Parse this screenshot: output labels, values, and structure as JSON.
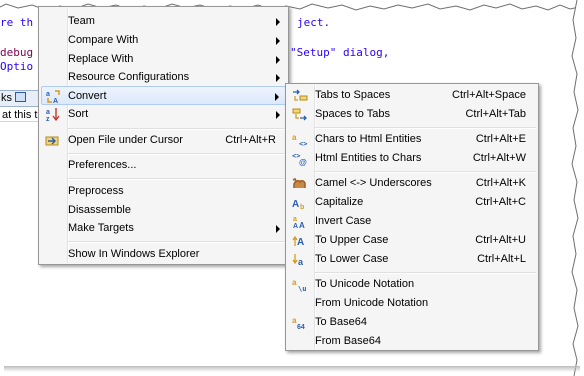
{
  "editor": {
    "lines": [
      {
        "text": "re th"
      },
      {
        "text": "ject."
      },
      {
        "text": "debug"
      },
      {
        "text": "\"Setup\" dialog,"
      },
      {
        "text": "Optio"
      }
    ],
    "tab_label": "ks",
    "status_text": "at this t"
  },
  "main_menu": {
    "items": [
      {
        "label": "Team",
        "accel": "",
        "submenu": true
      },
      {
        "label": "Compare With",
        "accel": "",
        "submenu": true
      },
      {
        "label": "Replace With",
        "accel": "",
        "submenu": true
      },
      {
        "label": "Resource Configurations",
        "accel": "",
        "submenu": true
      },
      {
        "label": "Convert",
        "accel": "",
        "submenu": true,
        "icon": "convert-icon"
      },
      {
        "label": "Sort",
        "accel": "",
        "submenu": true,
        "icon": "sort-az-icon"
      },
      {
        "label": "Open File under Cursor",
        "accel": "Ctrl+Alt+R",
        "submenu": false,
        "icon": "open-file-icon"
      },
      {
        "label": "Preferences...",
        "accel": "",
        "submenu": false
      },
      {
        "label": "Preprocess",
        "accel": "",
        "submenu": false
      },
      {
        "label": "Disassemble",
        "accel": "",
        "submenu": false
      },
      {
        "label": "Make Targets",
        "accel": "",
        "submenu": true
      },
      {
        "label": "Show In Windows Explorer",
        "accel": "",
        "submenu": false
      }
    ]
  },
  "convert_menu": {
    "items": [
      {
        "label": "Tabs to Spaces",
        "accel": "Ctrl+Alt+Space",
        "icon": "tabs-to-spaces-icon"
      },
      {
        "label": "Spaces to Tabs",
        "accel": "Ctrl+Alt+Tab",
        "icon": "spaces-to-tabs-icon"
      },
      {
        "label": "Chars to Html Entities",
        "accel": "Ctrl+Alt+E",
        "icon": "chars-to-html-icon"
      },
      {
        "label": "Html Entities to Chars",
        "accel": "Ctrl+Alt+W",
        "icon": "html-to-chars-icon"
      },
      {
        "label": "Camel <-> Underscores",
        "accel": "Ctrl+Alt+K",
        "icon": "camel-icon"
      },
      {
        "label": "Capitalize",
        "accel": "Ctrl+Alt+C",
        "icon": "capitalize-icon"
      },
      {
        "label": "Invert Case",
        "accel": "",
        "icon": "invert-case-icon"
      },
      {
        "label": "To Upper Case",
        "accel": "Ctrl+Alt+U",
        "icon": "upper-case-icon"
      },
      {
        "label": "To Lower Case",
        "accel": "Ctrl+Alt+L",
        "icon": "lower-case-icon"
      },
      {
        "label": "To Unicode Notation",
        "accel": "",
        "icon": "to-unicode-icon"
      },
      {
        "label": "From Unicode Notation",
        "accel": "",
        "icon": ""
      },
      {
        "label": "To Base64",
        "accel": "",
        "icon": "to-base64-icon"
      },
      {
        "label": "From Base64",
        "accel": "",
        "icon": ""
      }
    ]
  },
  "colors": {
    "menu_bg": "#f5f5f5",
    "highlight": "#dde8f9",
    "code_string": "#2a00ff",
    "code_keyword": "#7f0055"
  }
}
